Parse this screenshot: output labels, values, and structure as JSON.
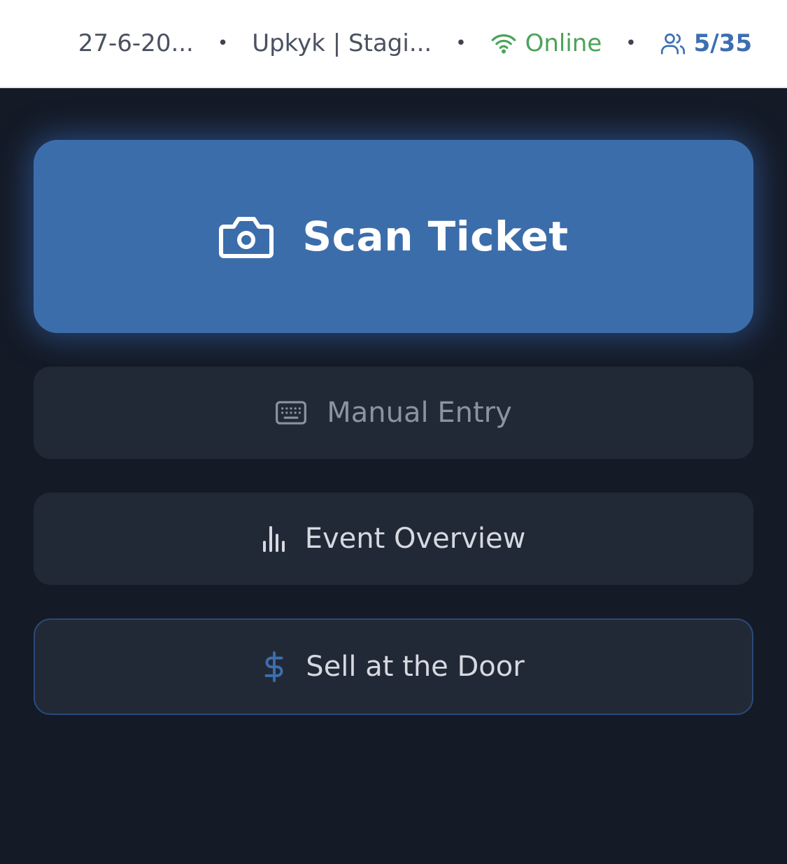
{
  "status_bar": {
    "date": "27-6-20...",
    "event_name": "Upkyk | Stagi...",
    "separator": "•",
    "connection": "Online",
    "attendance": "5/35",
    "icons": {
      "connection": "wifi-icon",
      "attendance": "users-icon"
    },
    "colors": {
      "online": "#4aa35a",
      "attendance": "#3d6fb0"
    }
  },
  "actions": {
    "scan": {
      "label": "Scan Ticket",
      "icon": "camera-icon",
      "color": "#3c6dab"
    },
    "manual": {
      "label": "Manual Entry",
      "icon": "keyboard-icon"
    },
    "overview": {
      "label": "Event Overview",
      "icon": "bar-chart-icon"
    },
    "sell": {
      "label": "Sell at the Door",
      "icon": "dollar-icon",
      "icon_color": "#3d6fb0"
    }
  }
}
